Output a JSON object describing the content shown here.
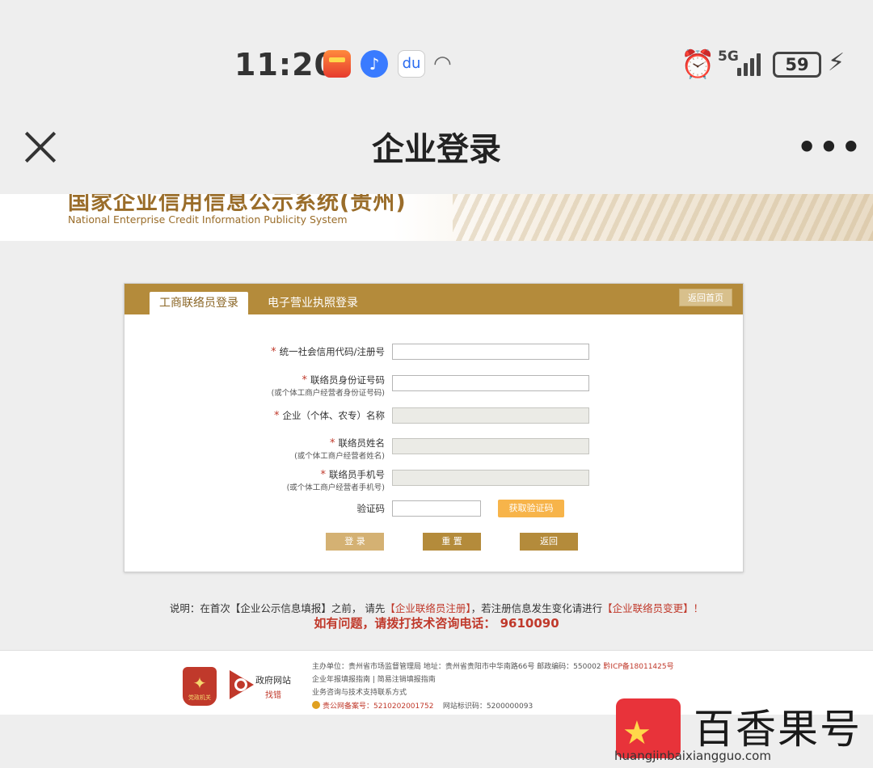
{
  "status_bar": {
    "time": "11:20",
    "network": "5G",
    "battery": "59"
  },
  "title_bar": {
    "title": "企业登录"
  },
  "banner": {
    "title_cn": "国家企业信用信息公示系统(贵州)",
    "title_en": "National Enterprise Credit Information Publicity System"
  },
  "login": {
    "tabs": [
      {
        "label": "工商联络员登录",
        "active": true
      },
      {
        "label": "电子营业执照登录",
        "active": false
      }
    ],
    "home_button": "返回首页",
    "fields": [
      {
        "label": "统一社会信用代码/注册号",
        "sub": "",
        "required": true,
        "disabled": false,
        "value": ""
      },
      {
        "label": "联络员身份证号码",
        "sub": "(或个体工商户经营者身份证号码)",
        "required": true,
        "disabled": false,
        "value": ""
      },
      {
        "label": "企业（个体、农专）名称",
        "sub": "",
        "required": true,
        "disabled": true,
        "value": ""
      },
      {
        "label": "联络员姓名",
        "sub": "(或个体工商户经营者姓名)",
        "required": true,
        "disabled": true,
        "value": ""
      },
      {
        "label": "联络员手机号",
        "sub": "(或个体工商户经营者手机号)",
        "required": true,
        "disabled": true,
        "value": ""
      }
    ],
    "captcha_label": "验证码",
    "get_code_button": "获取验证码",
    "buttons": {
      "login": "登 录",
      "reset": "重 置",
      "back": "返回"
    }
  },
  "notice": {
    "prefix": "说明：在首次【企业公示信息填报】之前，  请先",
    "register_link": "【企业联络员注册】",
    "middle": "，若注册信息发生变化请进行",
    "change_link": "【企业联络员变更】",
    "suffix": "！",
    "hotline": "如有问题，请拨打技术咨询电话：  9610090"
  },
  "footer": {
    "emblem_text": "党政机关",
    "gov_site_title": "政府网站",
    "gov_site_sub": "找错",
    "line1": "主办单位：贵州省市场监督管理局 地址：贵州省贵阳市中华南路66号 邮政编码：550002",
    "icp": "黔ICP备18011425号",
    "line2": "企业年报填报指南 | 简易注销填报指南",
    "line3": "业务咨询与技术支持联系方式",
    "police": "贵公网备案号：5210202001752",
    "site_code": "网站标识码：5200000093"
  },
  "watermark": {
    "name": "百香果号",
    "url": "huangjinbaixiangguo.com"
  }
}
